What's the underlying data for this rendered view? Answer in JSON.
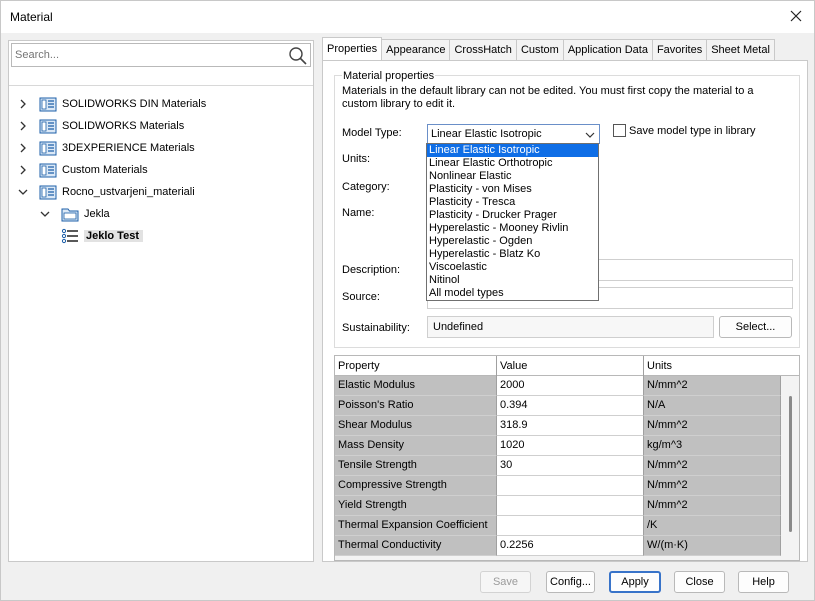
{
  "window": {
    "title": "Material"
  },
  "left": {
    "search": {
      "placeholder": "Search..."
    },
    "tree": [
      {
        "label": "SOLIDWORKS DIN Materials",
        "expanded": false
      },
      {
        "label": "SOLIDWORKS Materials",
        "expanded": false
      },
      {
        "label": "3DEXPERIENCE Materials",
        "expanded": false
      },
      {
        "label": "Custom Materials",
        "expanded": false
      },
      {
        "label": "Rocno_ustvarjeni_materiali",
        "expanded": true
      },
      {
        "label": "Jekla",
        "expanded": true
      },
      {
        "label": "Jeklo Test",
        "selected": true
      }
    ]
  },
  "tabs": [
    "Properties",
    "Appearance",
    "CrossHatch",
    "Custom",
    "Application Data",
    "Favorites",
    "Sheet Metal"
  ],
  "properties": {
    "group_title": "Material properties",
    "note": "Materials in the default library can not be edited. You must first copy the material to a custom library to edit it.",
    "labels": {
      "model_type": "Model Type:",
      "units": "Units:",
      "category": "Category:",
      "name": "Name:",
      "description": "Description:",
      "source": "Source:",
      "sustainability": "Sustainability:"
    },
    "model_type_value": "Linear Elastic Isotropic",
    "save_model_type_label": "Save model type in library",
    "sustainability_value": "Undefined",
    "select_button": "Select...",
    "dropdown_options": [
      "Linear Elastic Isotropic",
      "Linear Elastic Orthotropic",
      "Nonlinear Elastic",
      "Plasticity - von Mises",
      "Plasticity - Tresca",
      "Plasticity - Drucker Prager",
      "Hyperelastic - Mooney Rivlin",
      "Hyperelastic - Ogden",
      "Hyperelastic - Blatz Ko",
      "Viscoelastic",
      "Nitinol",
      "All model types"
    ]
  },
  "table": {
    "headers": [
      "Property",
      "Value",
      "Units"
    ],
    "rows": [
      [
        "Elastic Modulus",
        "2000",
        "N/mm^2"
      ],
      [
        "Poisson's Ratio",
        "0.394",
        "N/A"
      ],
      [
        "Shear Modulus",
        "318.9",
        "N/mm^2"
      ],
      [
        "Mass Density",
        "1020",
        "kg/m^3"
      ],
      [
        "Tensile Strength",
        "30",
        "N/mm^2"
      ],
      [
        "Compressive Strength",
        "",
        "N/mm^2"
      ],
      [
        "Yield Strength",
        "",
        "N/mm^2"
      ],
      [
        "Thermal Expansion Coefficient",
        "",
        "/K"
      ],
      [
        "Thermal Conductivity",
        "0.2256",
        "W/(m·K)"
      ]
    ]
  },
  "footer": {
    "save": "Save",
    "config": "Config...",
    "apply": "Apply",
    "close": "Close",
    "help": "Help"
  }
}
